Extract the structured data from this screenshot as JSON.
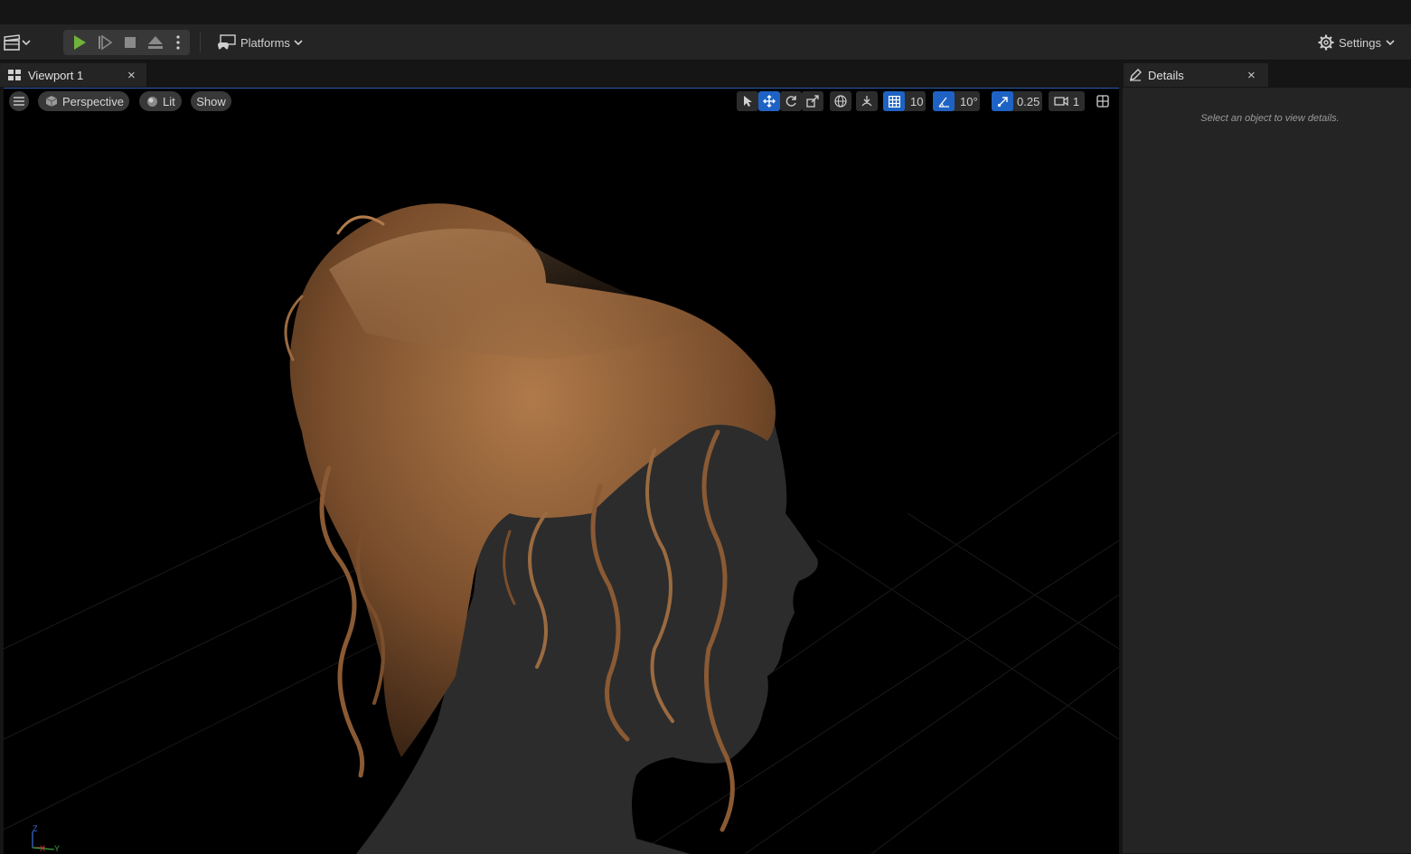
{
  "toolbar": {
    "platforms_label": "Platforms",
    "settings_label": "Settings"
  },
  "tabs": {
    "viewport_label": "Viewport 1",
    "details_label": "Details",
    "close_glyph": "×"
  },
  "viewport_toolbar": {
    "perspective_label": "Perspective",
    "lit_label": "Lit",
    "show_label": "Show",
    "grid_snap_value": "10",
    "rotation_snap_value": "10°",
    "scale_snap_value": "0.25",
    "camera_speed_value": "1"
  },
  "details_panel": {
    "empty_hint": "Select an object to view details."
  },
  "axis_gizmo": {
    "z": "Z",
    "x": "X",
    "y": "Y"
  },
  "colors": {
    "accent_blue": "#1e63c4",
    "play_green": "#6fb33a",
    "hair": "#8a5a34",
    "head": "#2c2c2c"
  }
}
